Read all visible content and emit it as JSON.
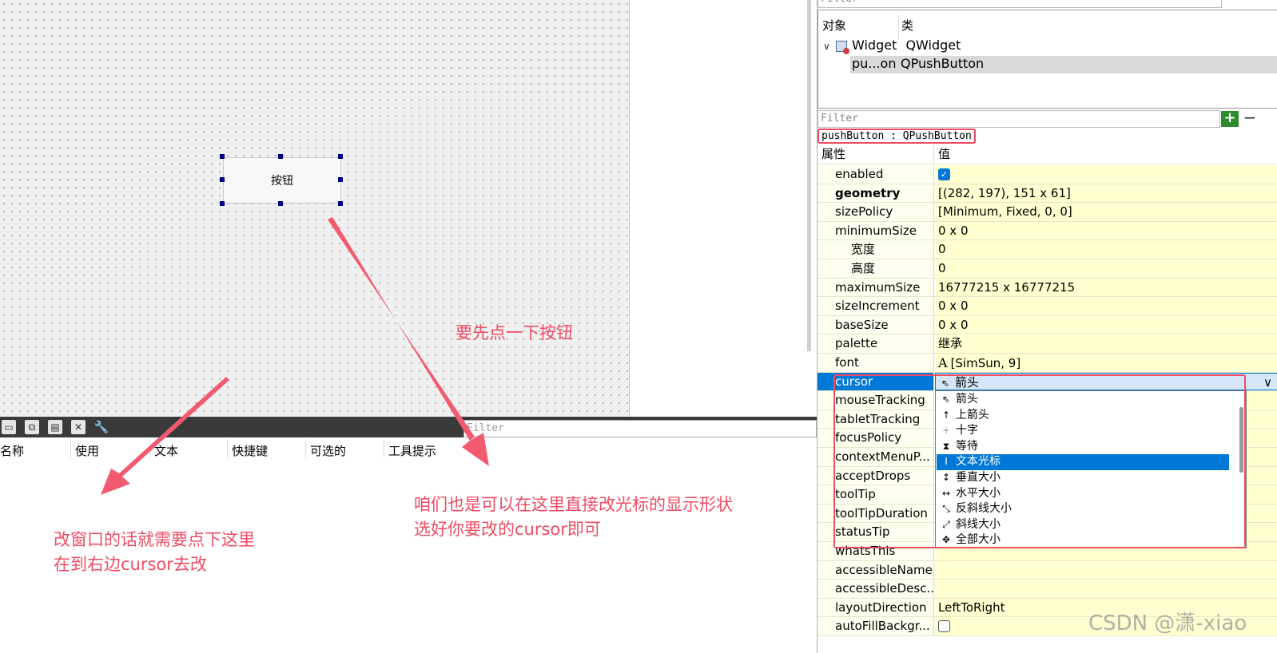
{
  "canvas": {
    "button_label": "按钮"
  },
  "annotations": {
    "click_button": "要先点一下按钮",
    "change_here_line1": "咱们也是可以在这里直接改光标的显示形状",
    "change_here_line2": "选好你要改的cursor即可",
    "window_line1": "改窗口的话就需要点下这里",
    "window_line2": "在到右边cursor去改"
  },
  "action_editor": {
    "filter_placeholder": "Filter",
    "columns": [
      "名称",
      "使用",
      "文本",
      "快捷键",
      "可选的",
      "工具提示"
    ]
  },
  "object_inspector": {
    "filter_placeholder": "Filter",
    "col_object": "对象",
    "col_class": "类",
    "rows": [
      {
        "object": "Widget",
        "class": "QWidget"
      },
      {
        "object": "pu...on",
        "class": "QPushButton"
      }
    ]
  },
  "property_editor": {
    "filter_placeholder": "Filter",
    "add_label": "+",
    "remove_label": "−",
    "object_label": "pushButton : QPushButton",
    "col_property": "属性",
    "col_value": "值",
    "rows": [
      {
        "name": "enabled",
        "value": ""
      },
      {
        "name": "geometry",
        "value": "[(282, 197), 151 x 61]"
      },
      {
        "name": "sizePolicy",
        "value": "[Minimum, Fixed, 0, 0]"
      },
      {
        "name": "minimumSize",
        "value": "0 x 0"
      },
      {
        "name": "宽度",
        "value": "0"
      },
      {
        "name": "高度",
        "value": "0"
      },
      {
        "name": "maximumSize",
        "value": "16777215 x 16777215"
      },
      {
        "name": "sizeIncrement",
        "value": "0 x 0"
      },
      {
        "name": "baseSize",
        "value": "0 x 0"
      },
      {
        "name": "palette",
        "value": "继承"
      },
      {
        "name": "font",
        "value": "[SimSun, 9]"
      },
      {
        "name": "cursor",
        "value": "箭头"
      },
      {
        "name": "mouseTracking",
        "value": ""
      },
      {
        "name": "tabletTracking",
        "value": ""
      },
      {
        "name": "focusPolicy",
        "value": ""
      },
      {
        "name": "contextMenuP...",
        "value": ""
      },
      {
        "name": "acceptDrops",
        "value": ""
      },
      {
        "name": "toolTip",
        "value": ""
      },
      {
        "name": "toolTipDuration",
        "value": ""
      },
      {
        "name": "statusTip",
        "value": ""
      },
      {
        "name": "whatsThis",
        "value": ""
      },
      {
        "name": "accessibleName",
        "value": ""
      },
      {
        "name": "accessibleDesc...",
        "value": ""
      },
      {
        "name": "layoutDirection",
        "value": "LeftToRight"
      },
      {
        "name": "autoFillBackgr...",
        "value": ""
      }
    ],
    "font_glyph": "A",
    "enabled_checked": true,
    "autofill_checked": false
  },
  "cursor_dropdown": {
    "options": [
      "箭头",
      "上箭头",
      "十字",
      "等待",
      "文本光标",
      "垂直大小",
      "水平大小",
      "反斜线大小",
      "斜线大小",
      "全部大小"
    ],
    "selected": "文本光标",
    "icons": [
      "arrow-cursor-icon",
      "up-arrow-cursor-icon",
      "cross-cursor-icon",
      "wait-cursor-icon",
      "ibeam-cursor-icon",
      "size-ver-cursor-icon",
      "size-hor-cursor-icon",
      "size-bdiag-cursor-icon",
      "size-fdiag-cursor-icon",
      "size-all-cursor-icon"
    ]
  },
  "watermark": "CSDN @潇-xiao",
  "colors": {
    "annotation": "#ef4b63",
    "selection": "#0078d7",
    "property_value_bg": "#ffffd0"
  }
}
